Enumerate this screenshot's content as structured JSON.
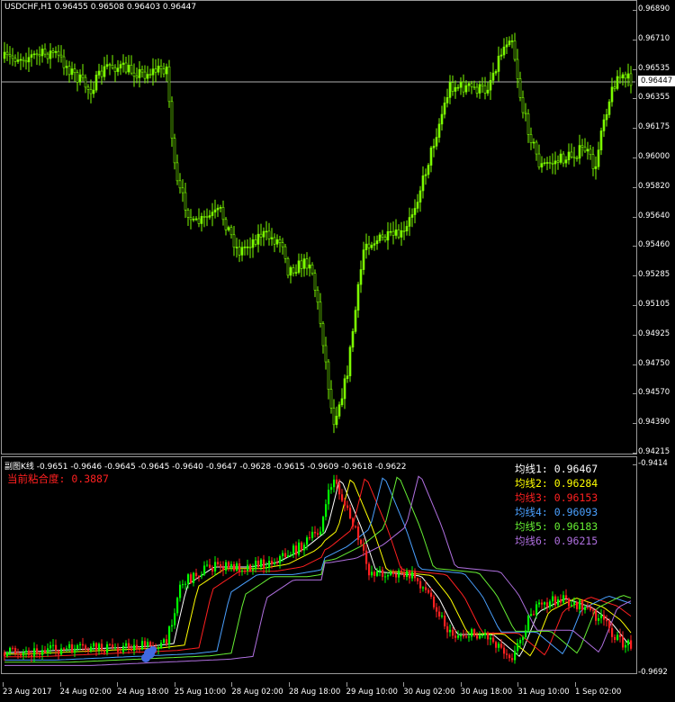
{
  "main": {
    "title": "USDCHF,H1  0.96455 0.96508 0.96403 0.96447",
    "current_price": "0.96447",
    "price_axis": [
      "0.96890",
      "0.96710",
      "0.96535",
      "0.96355",
      "0.96175",
      "0.96000",
      "0.95820",
      "0.95640",
      "0.95460",
      "0.95285",
      "0.95105",
      "0.94925",
      "0.94750",
      "0.94570",
      "0.94390",
      "0.94215"
    ]
  },
  "sub": {
    "title": "副图K线 -0.9651 -0.9646 -0.9645 -0.9645 -0.9640 -0.9647 -0.9628 -0.9615 -0.9609 -0.9618 -0.9622",
    "adhesion": "当前粘合度: 0.3887",
    "axis_top": "-0.9414",
    "axis_bottom": "-0.9692",
    "ma_rows": [
      {
        "text": "均线1: 0.96467",
        "color": "#ffffff"
      },
      {
        "text": "均线2: 0.96284",
        "color": "#ffff00"
      },
      {
        "text": "均线3: 0.96153",
        "color": "#ff2020"
      },
      {
        "text": "均线4: 0.96093",
        "color": "#4aa0ff"
      },
      {
        "text": "均线5: 0.96183",
        "color": "#66ee33"
      },
      {
        "text": "均线6: 0.96215",
        "color": "#b070e0"
      }
    ]
  },
  "time_axis": [
    "23 Aug 2017",
    "24 Aug 02:00",
    "24 Aug 18:00",
    "25 Aug 10:00",
    "28 Aug 02:00",
    "28 Aug 18:00",
    "29 Aug 10:00",
    "30 Aug 02:00",
    "30 Aug 18:00",
    "31 Aug 10:00",
    "1 Sep 02:00"
  ],
  "colors": {
    "bull": "#00ff00",
    "bear": "#ff2020",
    "main_candle": "#7cfc00",
    "grid": "#9a9a9a"
  }
}
